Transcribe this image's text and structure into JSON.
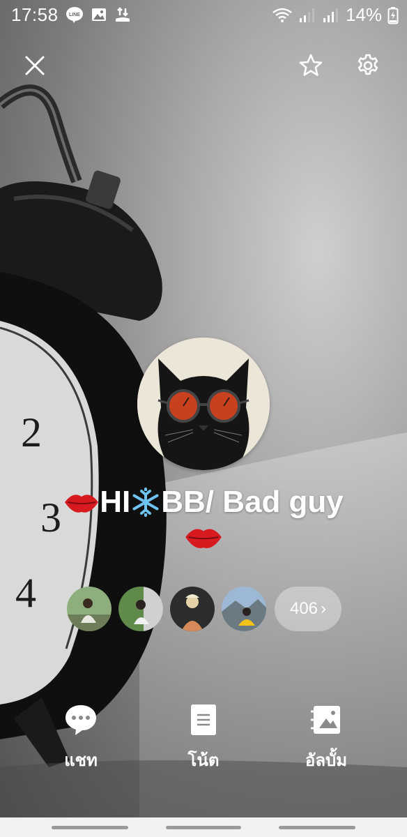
{
  "status_bar": {
    "time": "17:58",
    "battery": "14%",
    "icons": [
      "line-icon",
      "gallery-icon",
      "transfer-icon",
      "wifi-icon",
      "signal-icon",
      "signal-icon",
      "battery-charging-icon"
    ]
  },
  "top_bar": {
    "close_icon": "close-icon",
    "favorite_icon": "star-icon",
    "settings_icon": "gear-icon"
  },
  "profile": {
    "name_part1": "HI",
    "name_part2": "BB/ Bad guy",
    "name_emojis": [
      "lips-icon",
      "snowflake-icon",
      "lips-icon"
    ],
    "avatar": "cat-with-sunglasses-avatar"
  },
  "friends": {
    "count": "406",
    "count_suffix": "›"
  },
  "actions": [
    {
      "label": "แชท",
      "icon": "chat-bubble-icon"
    },
    {
      "label": "โน้ต",
      "icon": "note-icon"
    },
    {
      "label": "อัลบั้ม",
      "icon": "album-icon"
    }
  ],
  "colors": {
    "text": "#ffffff",
    "nav_bar": "#f2f2f2"
  }
}
